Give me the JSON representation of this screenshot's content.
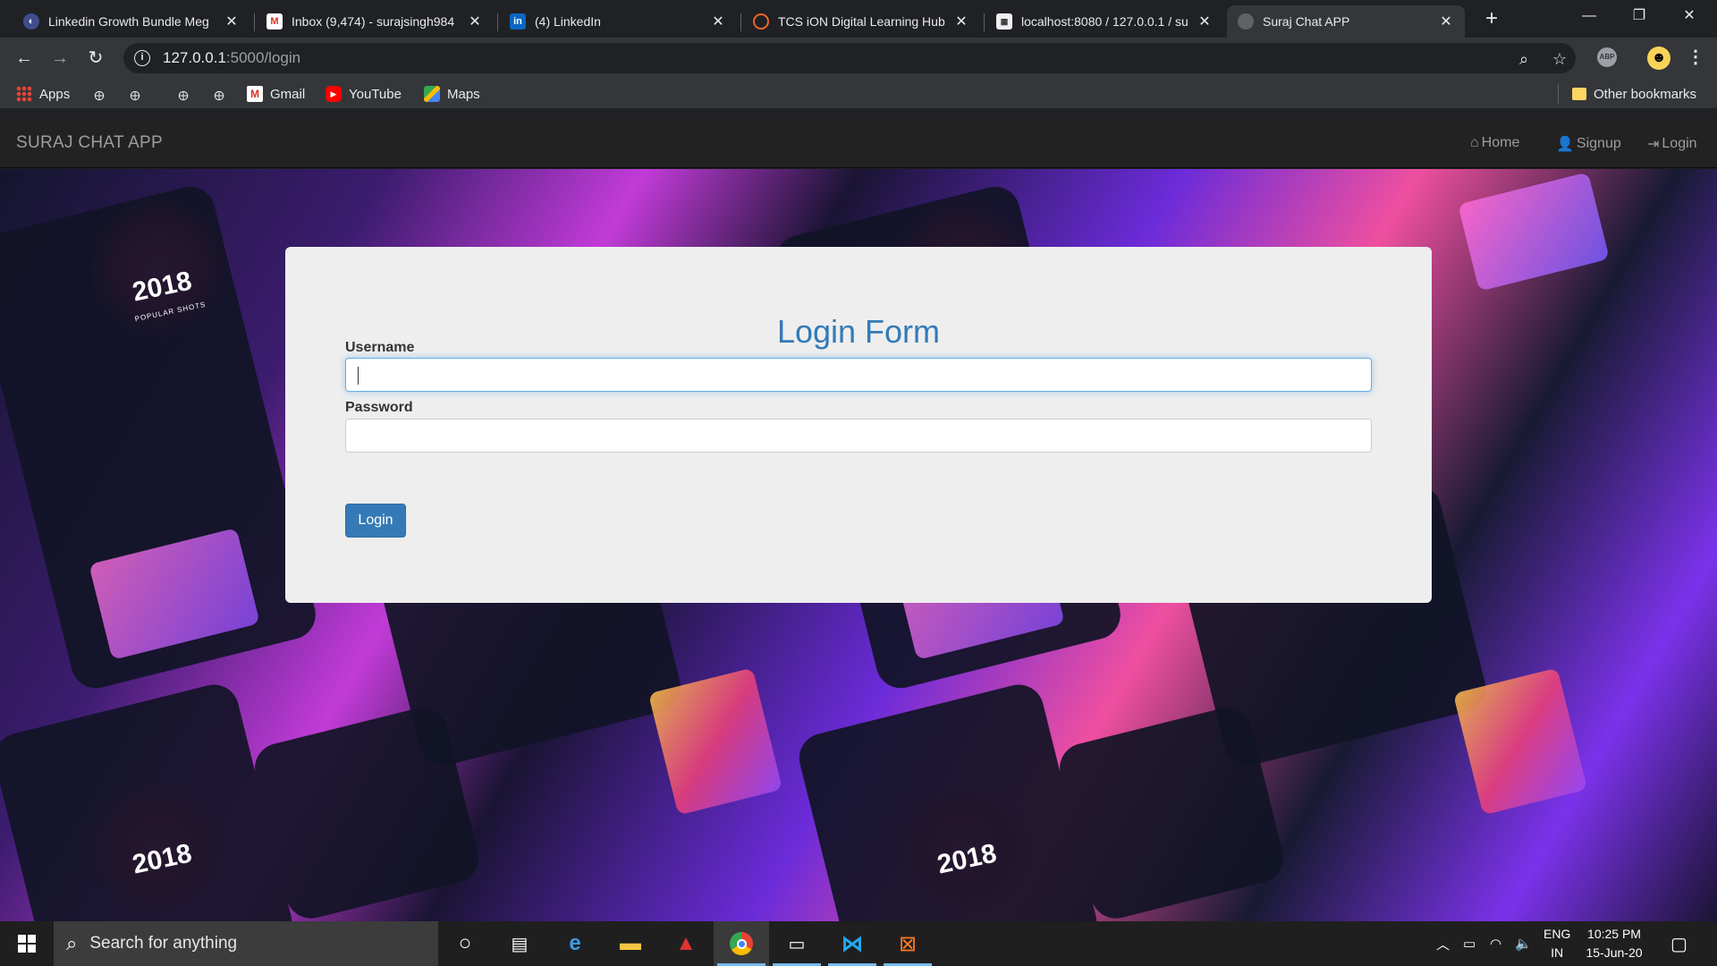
{
  "browser": {
    "tabs": [
      {
        "title": "Linkedin Growth Bundle Meg",
        "icon": "globe-icon",
        "active": false
      },
      {
        "title": "Inbox (9,474) - surajsingh984",
        "icon": "gmail-icon",
        "active": false
      },
      {
        "title": "(4) LinkedIn",
        "icon": "linkedin-icon",
        "active": false
      },
      {
        "title": "TCS iON Digital Learning Hub",
        "icon": "tcs-icon",
        "active": false
      },
      {
        "title": "localhost:8080 / 127.0.0.1 / su",
        "icon": "phpmyadmin-icon",
        "active": false
      },
      {
        "title": "Suraj Chat APP",
        "icon": "globe-icon",
        "active": true
      }
    ],
    "new_tab_glyph": "+",
    "url_host": "127.0.0.1",
    "url_path": ":5000/login",
    "bookmarks": [
      {
        "label": "Apps",
        "icon": "apps-grid-icon"
      },
      {
        "label": "",
        "icon": "globe-icon"
      },
      {
        "label": "",
        "icon": "globe-icon"
      },
      {
        "label": "",
        "icon": "globe-icon"
      },
      {
        "label": "",
        "icon": "globe-icon"
      },
      {
        "label": "Gmail",
        "icon": "gmail-icon"
      },
      {
        "label": "YouTube",
        "icon": "youtube-icon"
      },
      {
        "label": "Maps",
        "icon": "maps-icon"
      }
    ],
    "other_bookmarks": "Other bookmarks",
    "extension_abp": "ABP"
  },
  "app": {
    "brand": "SURAJ CHAT APP",
    "nav": [
      {
        "label": "Home",
        "icon": "home-icon"
      },
      {
        "label": "Signup",
        "icon": "user-icon"
      },
      {
        "label": "Login",
        "icon": "login-icon"
      }
    ],
    "background": {
      "year_text": "2018",
      "subtitle": "POPULAR SHOTS"
    },
    "form": {
      "title": "Login Form",
      "username_label": "Username",
      "username_value": "",
      "password_label": "Password",
      "password_value": "",
      "submit_label": "Login"
    }
  },
  "taskbar": {
    "search_placeholder": "Search for anything",
    "apps": [
      "cortana-icon",
      "task-view-icon",
      "edge-icon",
      "file-explorer-icon",
      "game-icon",
      "chrome-icon",
      "terminal-icon",
      "vscode-icon",
      "xampp-icon"
    ],
    "lang_top": "ENG",
    "lang_bottom": "IN",
    "time": "10:25 PM",
    "date": "15-Jun-20"
  },
  "colors": {
    "form_title": "#337ab7",
    "button_bg": "#337ab7",
    "navbar_bg": "#222222",
    "panel_bg": "#eeeeee"
  }
}
